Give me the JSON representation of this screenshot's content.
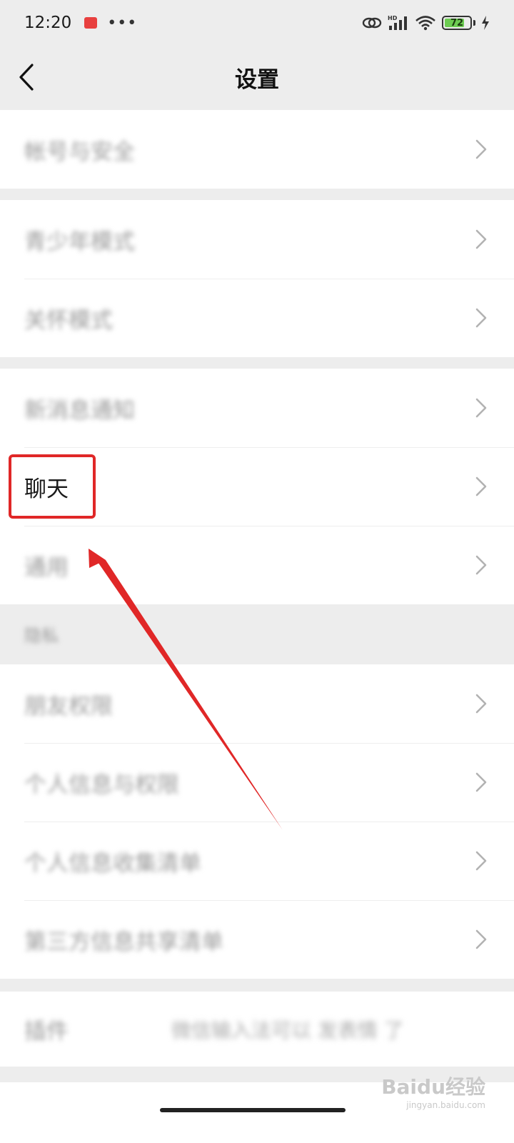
{
  "status_bar": {
    "time": "12:20",
    "more": "•••",
    "network": "HD",
    "battery": "72"
  },
  "nav": {
    "title": "设置"
  },
  "groups": {
    "account": {
      "item_1": "帐号与安全"
    },
    "mode": {
      "item_1": "青少年模式",
      "item_2": "关怀模式"
    },
    "general": {
      "item_1": "新消息通知",
      "item_2": "聊天",
      "item_3": "通用"
    },
    "privacy": {
      "header": "隐私",
      "item_1": "朋友权限",
      "item_2": "个人信息与权限",
      "item_3": "个人信息收集清单",
      "item_4": "第三方信息共享清单"
    },
    "plugins": {
      "left": "插件",
      "right": "微信输入法可以 发表情 了"
    }
  },
  "watermark": {
    "main": "Baidu经验",
    "sub": "jingyan.baidu.com"
  },
  "annotation": {
    "color": "#e02727"
  }
}
